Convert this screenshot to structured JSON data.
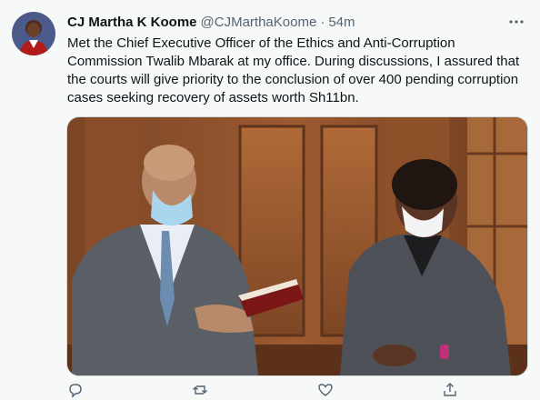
{
  "tweet": {
    "author_name": "CJ Martha K Koome",
    "author_handle": "@CJMarthaKoome",
    "separator": "·",
    "time": "54m",
    "text_lines": [
      "Met the Chief Executive Officer of the Ethics and Anti-Corruption",
      "Commission Twalib Mbarak at my office. During discussions, I assured that",
      "the courts will give priority to the conclusion of over 400 pending corruption",
      "cases seeking recovery of assets worth Sh11bn."
    ]
  },
  "icons": {
    "more": "more-icon",
    "reply": "reply-icon",
    "retweet": "retweet-icon",
    "like": "like-icon",
    "share": "share-icon"
  },
  "colors": {
    "background": "#f7f9f9",
    "text": "#0f1419",
    "secondary": "#536471",
    "border": "#cfd9de"
  }
}
